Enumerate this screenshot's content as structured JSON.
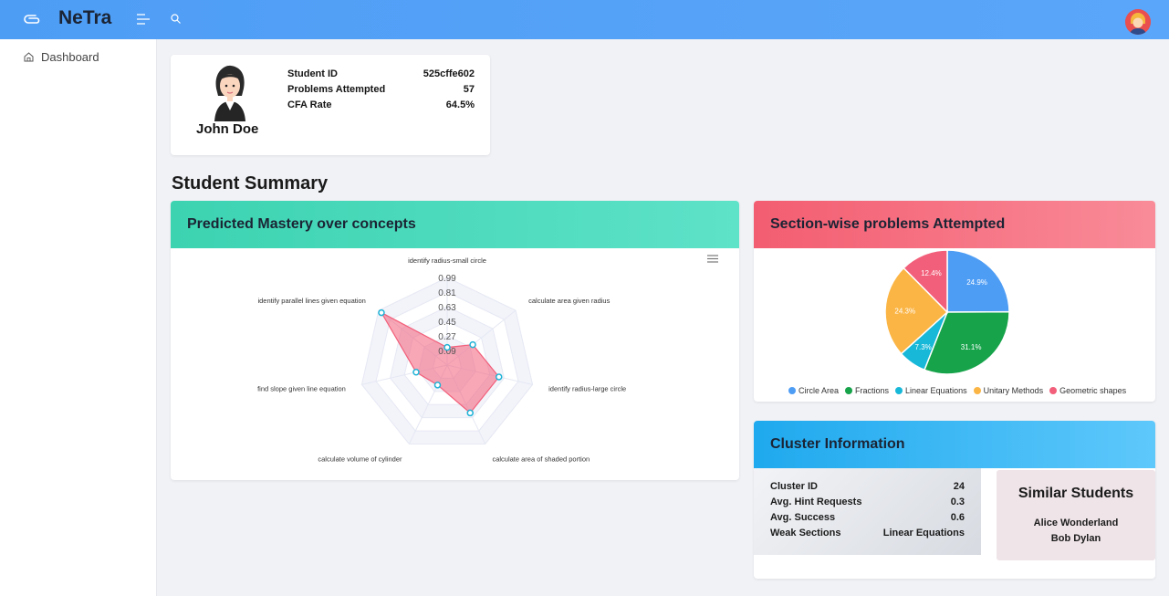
{
  "app": {
    "brand": "NeTra"
  },
  "sidebar": {
    "items": [
      {
        "label": "Dashboard"
      }
    ]
  },
  "profile": {
    "name": "John Doe",
    "stats": [
      {
        "label": "Student ID",
        "value": "525cffe602"
      },
      {
        "label": "Problems Attempted",
        "value": "57"
      },
      {
        "label": "CFA Rate",
        "value": "64.5%"
      }
    ]
  },
  "summary_title": "Student Summary",
  "mastery": {
    "title": "Predicted Mastery over concepts"
  },
  "sections": {
    "title": "Section-wise problems Attempted"
  },
  "cluster": {
    "title": "Cluster Information",
    "rows": [
      {
        "label": "Cluster ID",
        "value": "24"
      },
      {
        "label": "Avg. Hint Requests",
        "value": "0.3"
      },
      {
        "label": "Avg. Success",
        "value": "0.6"
      },
      {
        "label": "Weak Sections",
        "value": "Linear Equations"
      }
    ],
    "similar_title": "Similar Students",
    "similar": [
      "Alice Wonderland",
      "Bob Dylan"
    ]
  },
  "colors": {
    "topbar": "#5aa6fa",
    "mastery_header": "#3cd3b1",
    "section_header": "#f35d71",
    "cluster_header": "#1fa9ee"
  },
  "chart_data": [
    {
      "type": "radar",
      "categories": [
        "identify radius-small circle",
        "calculate area given radius",
        "identify radius-large circle",
        "calculate area of shaded portion",
        "calculate volume of cylinder",
        "find slope given line equation",
        "identify parallel lines given equation"
      ],
      "values": [
        0.2,
        0.37,
        0.6,
        0.6,
        0.25,
        0.36,
        0.95
      ],
      "tick_labels": [
        "0.99",
        "0.81",
        "0.63",
        "0.45",
        "0.27",
        "0.09"
      ],
      "ylim": [
        0,
        0.99
      ],
      "color": "#f25f7a"
    },
    {
      "type": "pie",
      "categories": [
        "Circle Area",
        "Fractions",
        "Linear Equations",
        "Unitary Methods",
        "Geometric shapes"
      ],
      "values": [
        24.9,
        31.1,
        7.3,
        24.3,
        12.4
      ],
      "labels": [
        "24.9%",
        "31.1%",
        "7.3%",
        "24.3%",
        "12.4%"
      ],
      "colors": [
        "#4e9df5",
        "#16a34a",
        "#17b8d8",
        "#fbb545",
        "#f25f7a"
      ],
      "legend": "bottom"
    }
  ]
}
